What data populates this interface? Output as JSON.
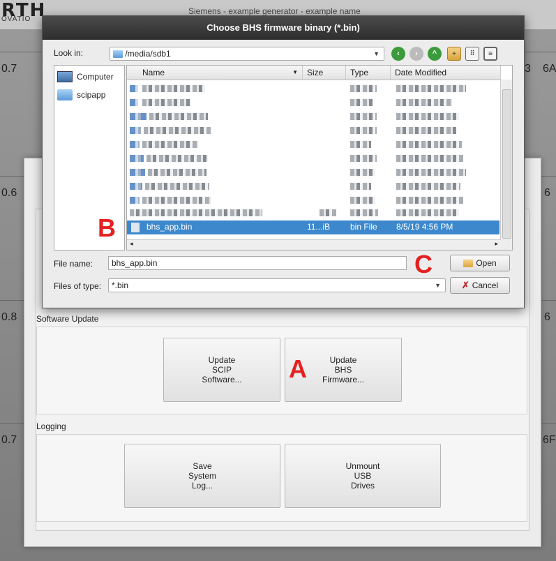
{
  "background": {
    "logo": "RTH",
    "logo_sub": "OVATIO",
    "subtitle": "Siemens - example generator - example name",
    "numbers": [
      "0.7",
      "3",
      "6A",
      "0.6",
      "6",
      "0.8",
      "6",
      "0.7",
      "6F"
    ]
  },
  "dialog": {
    "title": "Choose BHS firmware binary (*.bin)",
    "look_in_label": "Look in:",
    "look_in_value": "/media/sdb1",
    "places": [
      "Computer",
      "scipapp"
    ],
    "columns": [
      "Name",
      "Size",
      "Type",
      "Date Modified"
    ],
    "selected_file": {
      "name": "bhs_app.bin",
      "size": "11...iB",
      "type": "bin File",
      "date": "8/5/19 4:56 PM"
    },
    "file_name_label": "File name:",
    "file_name_value": "bhs_app.bin",
    "files_of_type_label": "Files of type:",
    "files_of_type_value": "*.bin",
    "open_label": "Open",
    "cancel_label": "Cancel"
  },
  "panel": {
    "software_update_label": "Software Update",
    "update_scip_label": "Update\nSCIP\nSoftware...",
    "update_bhs_label": "Update\nBHS\nFirmware...",
    "logging_label": "Logging",
    "save_log_label": "Save\nSystem\nLog...",
    "unmount_label": "Unmount\nUSB\nDrives"
  },
  "annotations": {
    "a": "A",
    "b": "B",
    "c": "C"
  },
  "colors": {
    "annotation_red": "#e52020",
    "selection_blue": "#3d88cc",
    "titlebar_dark": "#2e2e2e"
  }
}
